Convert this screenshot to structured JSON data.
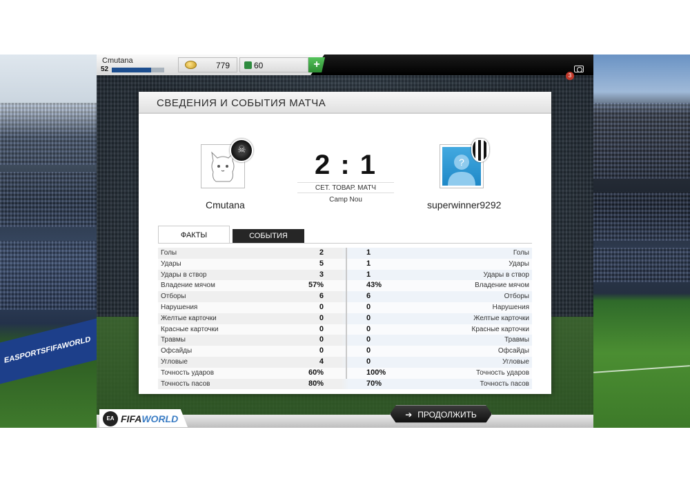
{
  "topbar": {
    "player_name": "Cmutana",
    "level": "52",
    "xp_progress": 0.75,
    "coins": "779",
    "points": "60",
    "plus_label": "+",
    "notification_count": "3"
  },
  "panel": {
    "title": "СВЕДЕНИЯ И СОБЫТИЯ МАТЧА"
  },
  "match": {
    "home_team": "Cmutana",
    "away_team": "superwinner9292",
    "score": "2 : 1",
    "match_type": "СЕТ. ТОВАР. МАТЧ",
    "stadium": "Camp Nou",
    "away_avatar_glyph": "?"
  },
  "tabs": {
    "facts": "ФАКТЫ",
    "events": "СОБЫТИЯ"
  },
  "stats": [
    {
      "label_l": "Голы",
      "val_l": "2",
      "val_r": "1",
      "label_r": "Голы"
    },
    {
      "label_l": "Удары",
      "val_l": "5",
      "val_r": "1",
      "label_r": "Удары"
    },
    {
      "label_l": "Удары в створ",
      "val_l": "3",
      "val_r": "1",
      "label_r": "Удары в створ"
    },
    {
      "label_l": "Владение мячом",
      "val_l": "57%",
      "val_r": "43%",
      "label_r": "Владение мячом"
    },
    {
      "label_l": "Отборы",
      "val_l": "6",
      "val_r": "6",
      "label_r": "Отборы"
    },
    {
      "label_l": "Нарушения",
      "val_l": "0",
      "val_r": "0",
      "label_r": "Нарушения"
    },
    {
      "label_l": "Желтые карточки",
      "val_l": "0",
      "val_r": "0",
      "label_r": "Желтые карточки"
    },
    {
      "label_l": "Красные карточки",
      "val_l": "0",
      "val_r": "0",
      "label_r": "Красные карточки"
    },
    {
      "label_l": "Травмы",
      "val_l": "0",
      "val_r": "0",
      "label_r": "Травмы"
    },
    {
      "label_l": "Офсайды",
      "val_l": "0",
      "val_r": "0",
      "label_r": "Офсайды"
    },
    {
      "label_l": "Угловые",
      "val_l": "4",
      "val_r": "0",
      "label_r": "Угловые"
    },
    {
      "label_l": "Точность ударов",
      "val_l": "60%",
      "val_r": "100%",
      "label_r": "Точность ударов"
    },
    {
      "label_l": "Точность пасов",
      "val_l": "80%",
      "val_r": "70%",
      "label_r": "Точность пасов"
    }
  ],
  "footer": {
    "continue_label": "ПРОДОЛЖИТЬ",
    "logo_ea": "EA",
    "logo_fifa": "FIFA",
    "logo_world": "WORLD"
  },
  "background": {
    "ad_text": "EASPORTSFIFAWORLD"
  }
}
